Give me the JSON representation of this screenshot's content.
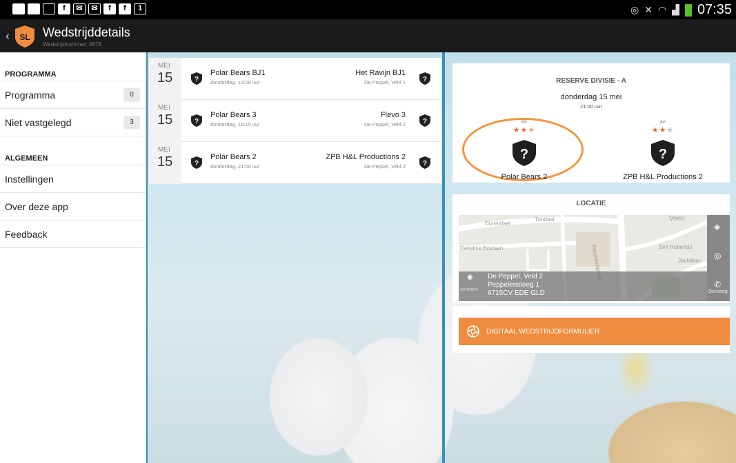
{
  "status_bar": {
    "time": "07:35",
    "notification_icons": [
      "message-icon",
      "message-icon",
      "image-icon",
      "facebook-icon",
      "email-icon",
      "email-icon",
      "facebook-icon",
      "facebook-icon",
      "calendar-icon"
    ],
    "calendar_day": "1",
    "right_icons": [
      "nfc-icon",
      "mute-icon",
      "wifi-icon",
      "signal-icon",
      "battery-icon"
    ]
  },
  "app_bar": {
    "logo_text": "SL",
    "title": "Wedstrijddetails",
    "subtitle": "Wedstrijdnummer: 4978",
    "colors": {
      "accent": "#f08c3e",
      "bar": "#1b1b1b"
    }
  },
  "sidebar": {
    "sections": [
      {
        "heading": "PROGRAMMA",
        "items": [
          {
            "label": "Programma",
            "count": "0"
          },
          {
            "label": "Niet vastgelegd",
            "count": "3"
          }
        ]
      },
      {
        "heading": "ALGEMEEN",
        "items": [
          {
            "label": "Instellingen"
          },
          {
            "label": "Over deze app"
          },
          {
            "label": "Feedback"
          }
        ]
      }
    ]
  },
  "matches": [
    {
      "month": "MEI",
      "day": "15",
      "home": "Polar Bears BJ1",
      "when": "donderdag, 13:00 uur",
      "away": "Het Ravijn BJ1",
      "venue": "De Peppel, Veld 1"
    },
    {
      "month": "MEI",
      "day": "15",
      "home": "Polar Bears 3",
      "when": "donderdag, 18:15 uur",
      "away": "Flevo 3",
      "venue": "De Peppel, Veld 2"
    },
    {
      "month": "MEI",
      "day": "15",
      "home": "Polar Bears 2",
      "when": "donderdag, 21:00 uur",
      "away": "ZPB H&L Productions 2",
      "venue": "De Peppel, Veld 2"
    }
  ],
  "detail": {
    "division": "RESERVE DIVISIE - A",
    "date": "donderdag 15 mei",
    "time": "21:00 uur",
    "home": {
      "rank": "6e",
      "stars": "★★",
      "half_star": "★",
      "name": "Polar Bears 2"
    },
    "away": {
      "rank": "4e",
      "stars": "★★",
      "off_star": "★",
      "name": "ZPB H&L Productions 2"
    }
  },
  "location": {
    "heading": "LOCATIE",
    "venue": "De Peppel, Veld 2",
    "street": "Peppelensteeg 1",
    "city": "6715CV EDE GLD",
    "map_labels": [
      "Durendael",
      "Tundaal",
      "Veen",
      "Dekeltse Boslaan",
      "Peppelensteeg",
      "Sint Hubertus",
      "Jachtlaan",
      "schoten",
      "Dorsweg"
    ]
  },
  "form_button": {
    "label": "DIGITAAL WEDSTRIJDFORMULIER"
  }
}
